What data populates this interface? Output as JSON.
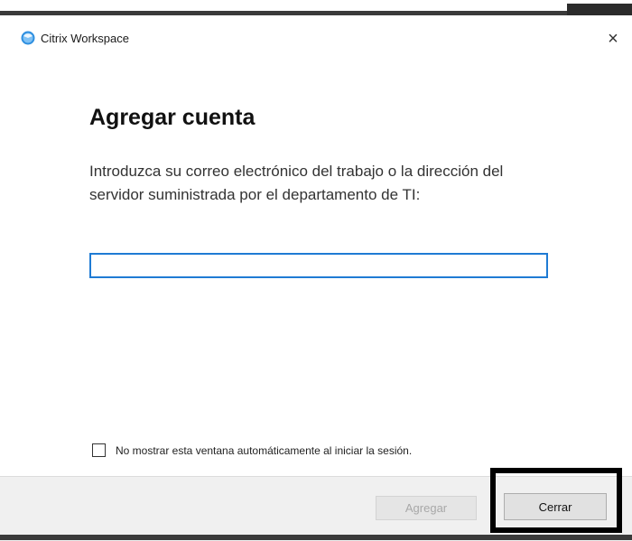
{
  "window": {
    "title": "Citrix Workspace",
    "icon": "citrix-workspace-icon",
    "close_glyph": "×"
  },
  "dialog": {
    "heading": "Agregar cuenta",
    "instructions": "Introduzca su correo electrónico del trabajo o la dirección del servidor suministrada por el departamento de TI:",
    "input": {
      "value": "",
      "placeholder": ""
    },
    "checkbox": {
      "label": "No mostrar esta ventana automáticamente al iniciar la sesión.",
      "checked": false
    }
  },
  "footer": {
    "add_label": "Agregar",
    "close_label": "Cerrar"
  },
  "colors": {
    "input_focus_border": "#1f7bd4",
    "icon_blue": "#2e8fe0",
    "highlight_box": "#000000",
    "footer_bg": "#f0f0f0"
  }
}
